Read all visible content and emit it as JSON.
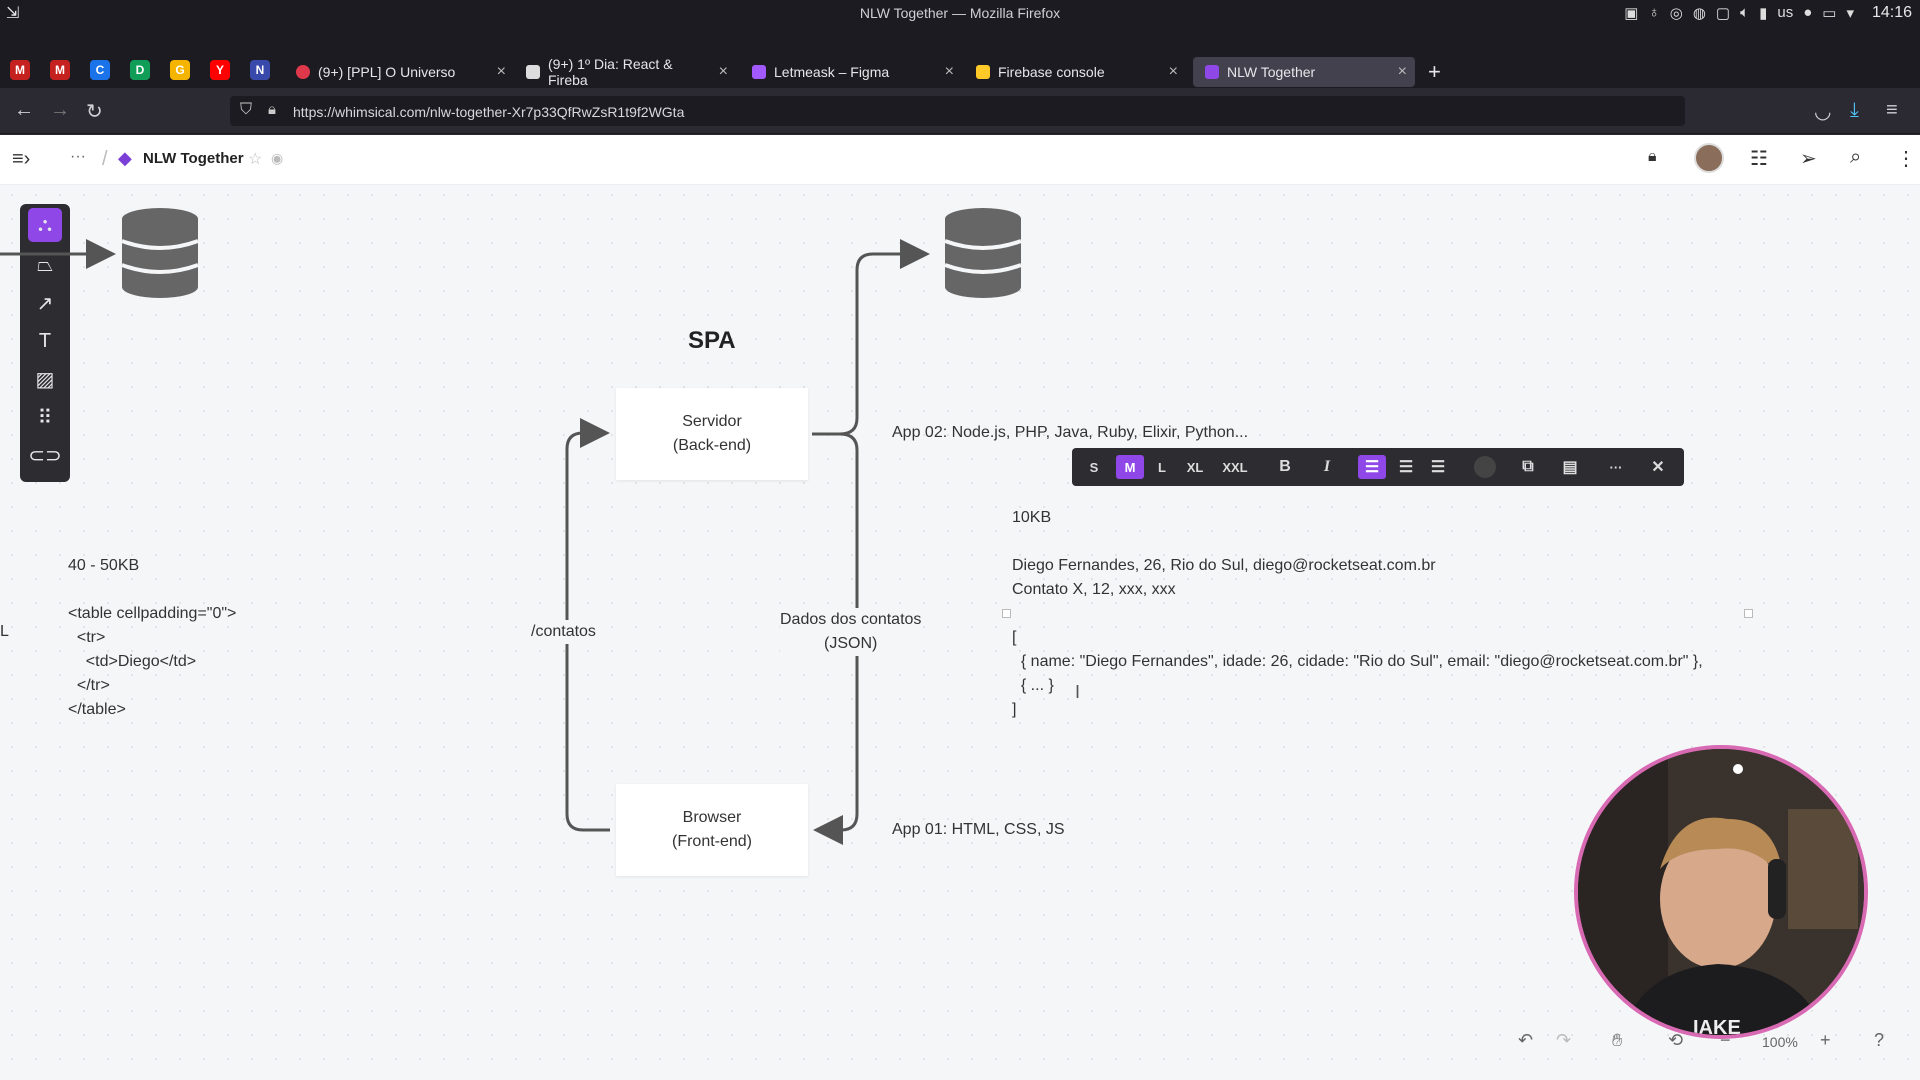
{
  "os": {
    "window_title": "NLW Together — Mozilla Firefox",
    "clock": "14:16",
    "keyboard": "us"
  },
  "tabs": [
    {
      "label": "(9+) [PPL] O Universo",
      "color": "#e0384b"
    },
    {
      "label": "(9+) 1º Dia: React & Fireba",
      "color": "#dddddd"
    },
    {
      "label": "Letmeask – Figma",
      "color": "#a259ff"
    },
    {
      "label": "Firebase console",
      "color": "#ffca28"
    },
    {
      "label": "NLW Together",
      "color": "#8f47e8"
    }
  ],
  "pinned_tabs": [
    "M",
    "M",
    "C",
    "D",
    "G",
    "Y",
    "N"
  ],
  "new_tab": "+",
  "url": "https://whimsical.com/nlw-together-Xr7p33QfRwZsR1t9f2WGta",
  "app": {
    "doc_title": "NLW Together",
    "more": "···"
  },
  "diagram": {
    "title": "SPA",
    "server_box": "Servidor\n(Back-end)",
    "browser_box": "Browser\n(Front-end)",
    "route_label": "/contatos",
    "data_label": "Dados dos contatos\n(JSON)",
    "app02_label": "App 02: Node.js, PHP, Java, Ruby, Elixir, Python...",
    "app01_label": "App 01: HTML, CSS, JS",
    "size_left": "40 - 50KB",
    "html_code": "<table cellpadding=\"0\">\n  <tr>\n    <td>Diego</td>\n  </tr>\n</table>",
    "size_right": "10KB",
    "contacts_text": "Diego Fernandes, 26, Rio do Sul, diego@rocketseat.com.br\nContato X, 12, xxx, xxx",
    "json_text": "[\n  { name: \"Diego Fernandes\", idade: 26, cidade: \"Rio do Sul\", email: \"diego@rocketseat.com.br\" },\n  { ... }\n]",
    "left_edge_char": "L"
  },
  "format_toolbar": {
    "sizes": [
      "S",
      "M",
      "L",
      "XL",
      "XXL"
    ],
    "active_size": "M",
    "bold": "B",
    "italic": "I",
    "more": "···",
    "close": "✕"
  },
  "zoom": "100%"
}
